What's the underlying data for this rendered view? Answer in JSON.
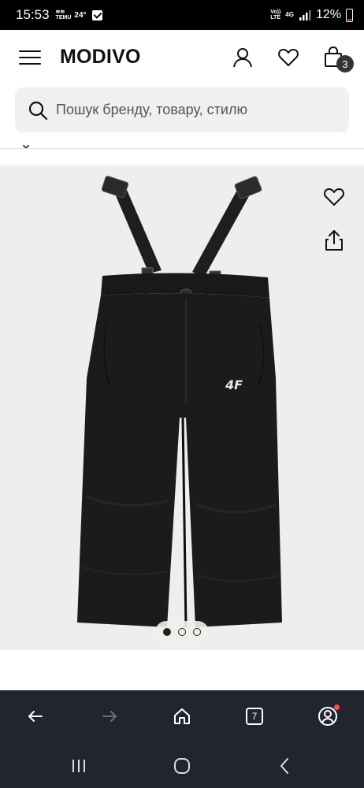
{
  "status_bar": {
    "time": "15:53",
    "mini_line1": "≋≋",
    "mini_line2": "TEMU",
    "temperature": "24°",
    "volte_line1": "Vo))",
    "volte_line2": "LTE",
    "network": "4G",
    "battery": "12%"
  },
  "header": {
    "logo": "MODIVO",
    "cart_count": "3"
  },
  "search": {
    "placeholder": "Пошук бренду, товару, стилю"
  },
  "product": {
    "brand_mark": "4F",
    "gallery_total": 3,
    "gallery_active_index": 0
  },
  "browser_bar": {
    "tab_count": "7"
  },
  "colors": {
    "status_bar_bg": "#000000",
    "image_bg": "#efeeec",
    "browser_bar_bg": "#202530",
    "badge_bg": "#333333",
    "notification_dot": "#ff4d4d"
  },
  "icons": {
    "menu": "hamburger-icon",
    "account": "user-icon",
    "wishlist": "heart-icon",
    "cart": "shopping-bag-icon",
    "search": "search-icon",
    "share": "share-icon",
    "back": "arrow-left-icon",
    "forward": "arrow-right-icon",
    "home": "home-icon",
    "tabs": "tabs-icon",
    "profile": "profile-icon"
  }
}
